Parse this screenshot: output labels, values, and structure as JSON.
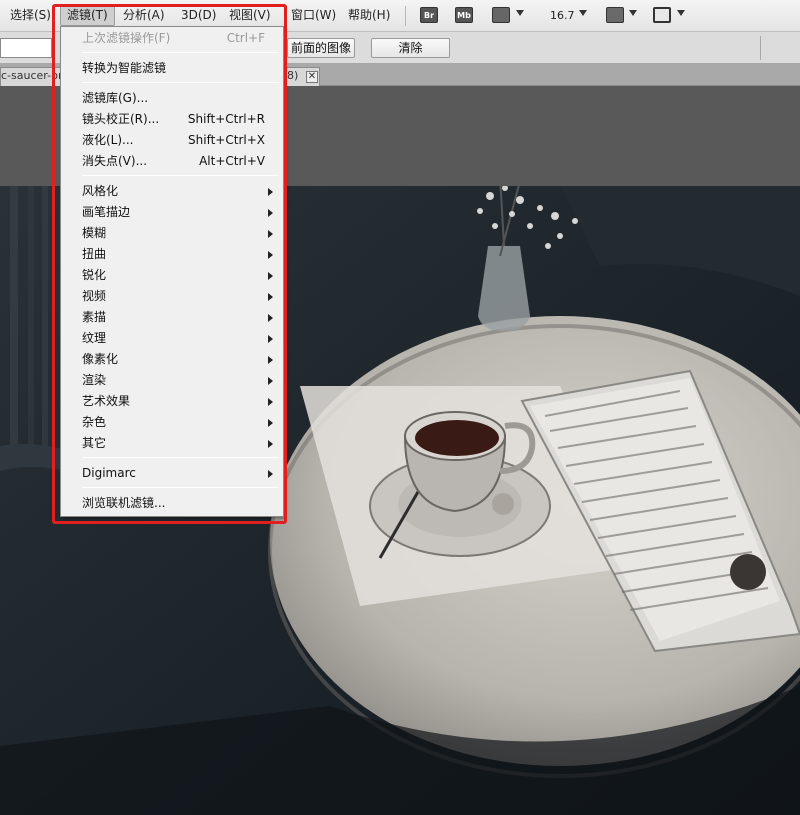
{
  "menubar": {
    "items": [
      {
        "label": "选择(S)"
      },
      {
        "label": "滤镜(T)"
      },
      {
        "label": "分析(A)"
      },
      {
        "label": "3D(D)"
      },
      {
        "label": "视图(V)"
      },
      {
        "label": "窗口(W)"
      },
      {
        "label": "帮助(H)"
      }
    ],
    "toolbar": {
      "bridge_icon": "Br",
      "minibridge_icon": "Mb",
      "zoom": "16.7"
    }
  },
  "options": {
    "front_image_label": "前面的图像",
    "clear_label": "清除"
  },
  "tab": {
    "label": "c-saucer-on",
    "suffix": "8)",
    "close": "✕"
  },
  "filter_menu": {
    "items": [
      {
        "label": "上次滤镜操作(F)",
        "shortcut": "Ctrl+F",
        "disabled": true
      },
      {
        "label": "转换为智能滤镜"
      },
      {
        "label": "滤镜库(G)..."
      },
      {
        "label": "镜头校正(R)...",
        "shortcut": "Shift+Ctrl+R"
      },
      {
        "label": "液化(L)...",
        "shortcut": "Shift+Ctrl+X"
      },
      {
        "label": "消失点(V)...",
        "shortcut": "Alt+Ctrl+V"
      },
      {
        "label": "风格化",
        "submenu": true
      },
      {
        "label": "画笔描边",
        "submenu": true
      },
      {
        "label": "模糊",
        "submenu": true
      },
      {
        "label": "扭曲",
        "submenu": true
      },
      {
        "label": "锐化",
        "submenu": true
      },
      {
        "label": "视频",
        "submenu": true
      },
      {
        "label": "素描",
        "submenu": true
      },
      {
        "label": "纹理",
        "submenu": true
      },
      {
        "label": "像素化",
        "submenu": true
      },
      {
        "label": "渲染",
        "submenu": true
      },
      {
        "label": "艺术效果",
        "submenu": true
      },
      {
        "label": "杂色",
        "submenu": true
      },
      {
        "label": "其它",
        "submenu": true
      },
      {
        "label": "Digimarc",
        "submenu": true
      },
      {
        "label": "浏览联机滤镜..."
      }
    ]
  },
  "colors": {
    "highlight": "#e02020",
    "menu_bg": "#f0f0f0",
    "photo_bg": "#171e24"
  }
}
